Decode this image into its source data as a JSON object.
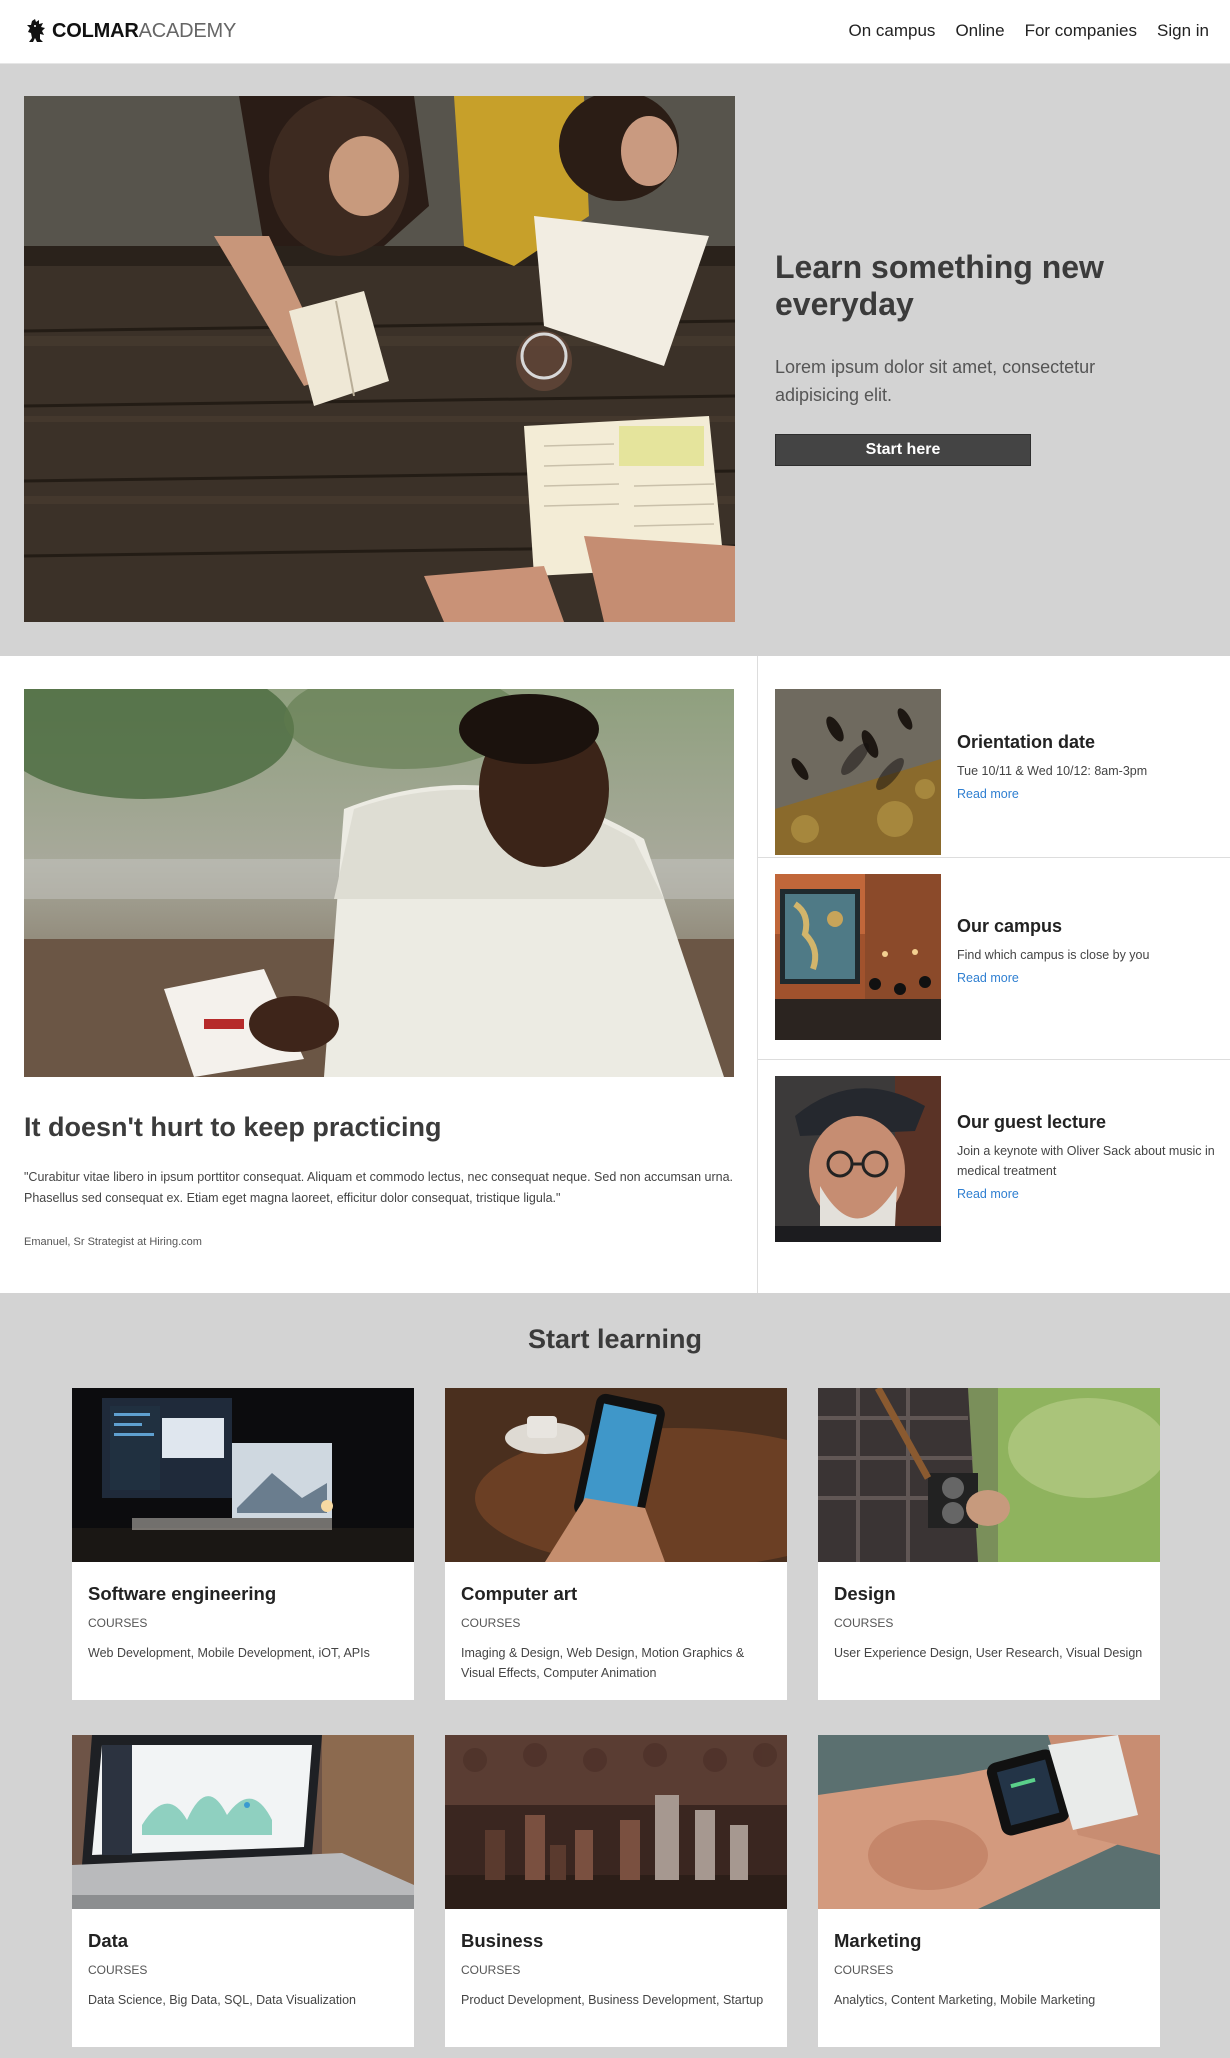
{
  "header": {
    "logo_bold": "COLMAR",
    "logo_light": "ACADEMY",
    "logo_icon": "lion-icon",
    "nav": [
      {
        "label": "On campus"
      },
      {
        "label": "Online"
      },
      {
        "label": "For companies"
      },
      {
        "label": "Sign in"
      }
    ]
  },
  "hero": {
    "image": "students-studying-photo",
    "title": "Learn something new everyday",
    "subtitle": "Lorem ipsum dolor sit amet, consectetur adipisicing elit.",
    "button": "Start here"
  },
  "feature": {
    "image": "man-reading-photo",
    "title": "It doesn't hurt to keep practicing",
    "quote": "\"Curabitur vitae libero in ipsum porttitor consequat. Aliquam et commodo lectus, nec consequat neque. Sed non accumsan urna. Phasellus sed consequat ex. Etiam eget magna laoreet, efficitur dolor consequat, tristique ligula.\"",
    "author": "Emanuel, Sr Strategist at Hiring.com"
  },
  "events": [
    {
      "title": "Orientation date",
      "desc": "Tue 10/11 & Wed 10/12: 8am-3pm",
      "link": "Read more",
      "image": "people-walking-photo"
    },
    {
      "title": "Our campus",
      "desc": "Find which campus is close by you",
      "link": "Read more",
      "image": "campus-interior-photo"
    },
    {
      "title": "Our guest lecture",
      "desc": "Join a keynote with Oliver Sack about music in medical treatment",
      "link": "Read more",
      "image": "old-man-portrait-photo"
    }
  ],
  "learn": {
    "title": "Start learning",
    "cards": [
      {
        "title": "Software engineering",
        "kicker": "COURSES",
        "desc": "Web Development, Mobile Development, iOT, APIs",
        "image": "desk-monitors-photo"
      },
      {
        "title": "Computer art",
        "kicker": "COURSES",
        "desc": "Imaging & Design, Web Design, Motion Graphics & Visual Effects, Computer Animation",
        "image": "phone-in-hand-photo"
      },
      {
        "title": "Design",
        "kicker": "COURSES",
        "desc": "User Experience Design, User Research, Visual Design",
        "image": "camera-photo"
      },
      {
        "title": "Data",
        "kicker": "COURSES",
        "desc": "Data Science, Big Data, SQL, Data Visualization",
        "image": "laptop-analytics-photo"
      },
      {
        "title": "Business",
        "kicker": "COURSES",
        "desc": "Product Development, Business Development, Startup",
        "image": "chess-pieces-photo"
      },
      {
        "title": "Marketing",
        "kicker": "COURSES",
        "desc": "Analytics, Content Marketing, Mobile Marketing",
        "image": "smartwatch-photo"
      }
    ]
  },
  "colors": {
    "section_bg": "#d3d3d3",
    "button_bg": "#444444",
    "link": "#2f7fd1",
    "heading": "#3b3b3b"
  }
}
